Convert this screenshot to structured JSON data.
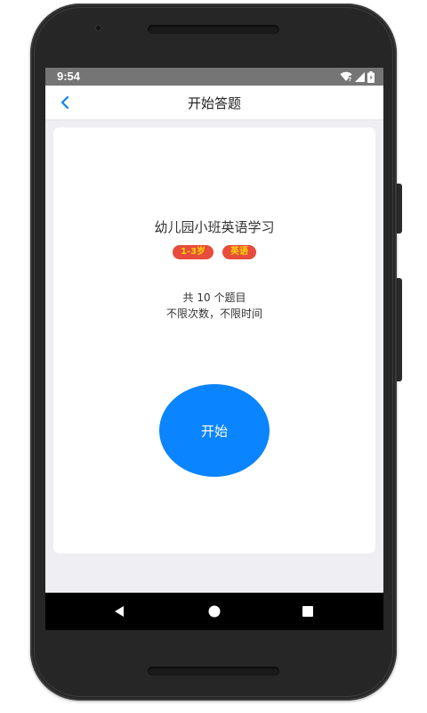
{
  "status_bar": {
    "time": "9:54",
    "icons": [
      "wifi-icon",
      "signal-icon",
      "battery-icon"
    ]
  },
  "header": {
    "back_icon": "chevron-left-icon",
    "title": "开始答题"
  },
  "quiz": {
    "title": "幼儿园小班英语学习",
    "tags": [
      {
        "label": "1-3岁",
        "bg": "#e74c3c",
        "color": "#ffd700"
      },
      {
        "label": "英语",
        "bg": "#e74c3c",
        "color": "#ffd700"
      }
    ],
    "question_count_text": "共 10 个题目",
    "limit_text": "不限次数，不限时间",
    "start_label": "开始"
  },
  "system_nav": {
    "back": "triangle-back-icon",
    "home": "circle-home-icon",
    "recents": "square-recents-icon"
  },
  "colors": {
    "accent": "#0a84ff",
    "screen_bg": "#eeeef3",
    "status_bar": "#757575"
  }
}
